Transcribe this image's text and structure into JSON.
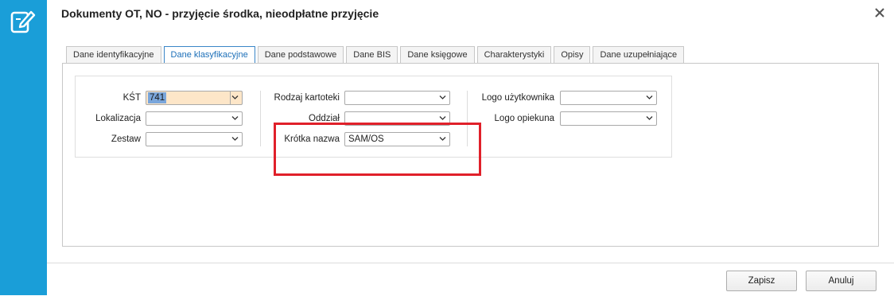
{
  "window": {
    "title": "Dokumenty OT, NO - przyjęcie środka, nieodpłatne przyjęcie",
    "app_icon": "document-edit-icon",
    "close_icon": "close-icon"
  },
  "tabs": [
    {
      "label": "Dane identyfikacyjne",
      "active": false
    },
    {
      "label": "Dane klasyfikacyjne",
      "active": true
    },
    {
      "label": "Dane podstawowe",
      "active": false
    },
    {
      "label": "Dane BIS",
      "active": false
    },
    {
      "label": "Dane księgowe",
      "active": false
    },
    {
      "label": "Charakterystyki",
      "active": false
    },
    {
      "label": "Opisy",
      "active": false
    },
    {
      "label": "Dane uzupełniające",
      "active": false
    }
  ],
  "form": {
    "col1": {
      "kst": {
        "label": "KŚT",
        "value": "741"
      },
      "lokalizacja": {
        "label": "Lokalizacja",
        "value": ""
      },
      "zestaw": {
        "label": "Zestaw",
        "value": ""
      }
    },
    "col2": {
      "rodzaj_kartoteki": {
        "label": "Rodzaj kartoteki",
        "value": ""
      },
      "oddzial": {
        "label": "Oddział",
        "value": ""
      },
      "krotka_nazwa": {
        "label": "Krótka nazwa",
        "value": "SAM/OS"
      }
    },
    "col3": {
      "logo_uzytkownika": {
        "label": "Logo użytkownika",
        "value": ""
      },
      "logo_opiekuna": {
        "label": "Logo opiekuna",
        "value": ""
      }
    }
  },
  "footer": {
    "save_label": "Zapisz",
    "cancel_label": "Anuluj"
  },
  "colors": {
    "sidebar": "#1a9ed8",
    "highlight": "#e0202a",
    "active_tab": "#1c6fb8",
    "kst_field_bg": "#fde6c8",
    "selection": "#7aa6db"
  }
}
